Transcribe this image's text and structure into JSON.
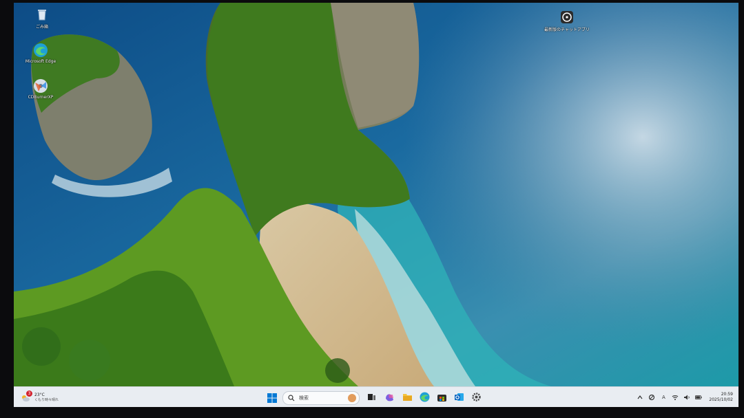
{
  "desktop": {
    "icons": [
      {
        "label": "ごみ箱",
        "icon": "recycle-bin-icon"
      },
      {
        "label": "Microsoft Edge",
        "icon": "edge-icon"
      },
      {
        "label": "CDBurnerXP",
        "icon": "cdburner-icon"
      },
      {
        "label": "最新版のチャットアプリ",
        "icon": "chat-app-icon"
      }
    ]
  },
  "taskbar": {
    "weather": {
      "badge": "3",
      "temp": "23°C",
      "condition": "くもり時々晴れ"
    },
    "search": {
      "placeholder": "検索"
    },
    "apps": [
      "task-view-icon",
      "copilot-icon",
      "file-explorer-icon",
      "edge-icon",
      "store-icon",
      "outlook-icon",
      "settings-icon"
    ],
    "tray": {
      "ime": "A"
    },
    "clock": {
      "time": "20:59",
      "date": "2025/10/02"
    }
  },
  "colors": {
    "accent": "#0078d4",
    "taskbar_bg": "#e9edf2"
  }
}
